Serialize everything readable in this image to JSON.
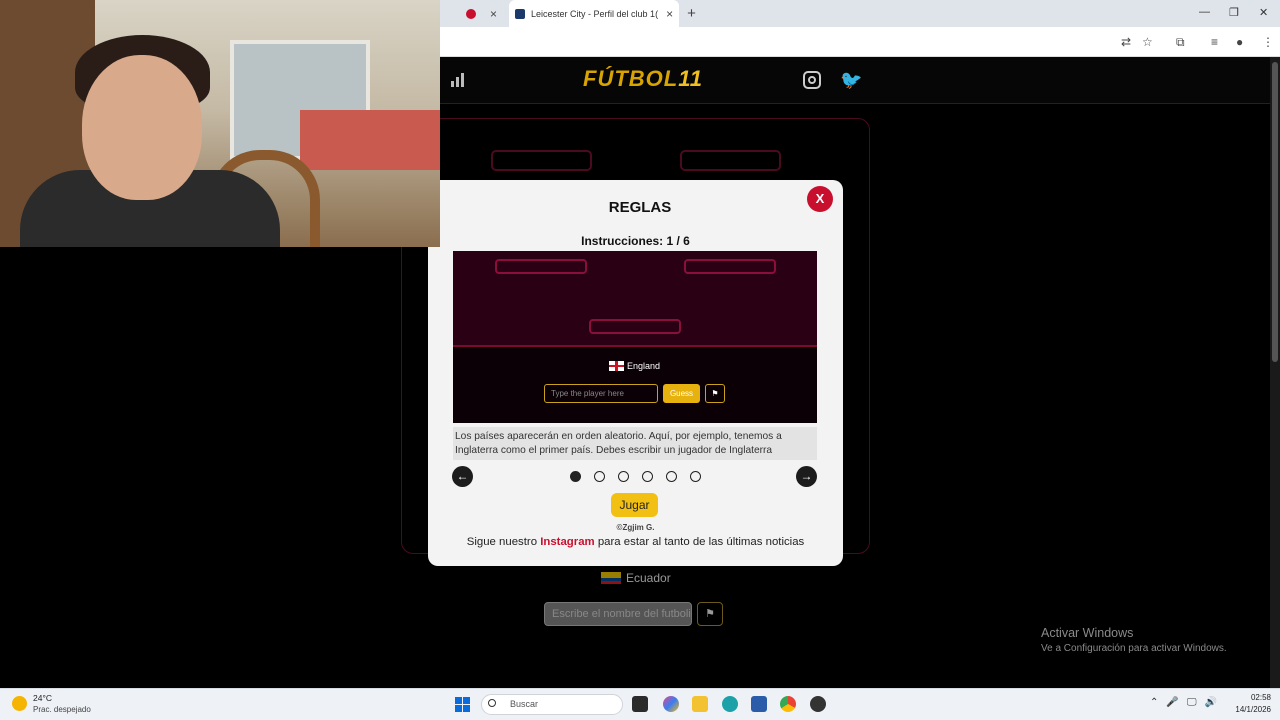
{
  "browser": {
    "tabs": [
      {
        "label": "",
        "favicon_color": "#c8102e"
      },
      {
        "label": "Leicester City - Perfil del club 1(",
        "favicon_color": "#1b3a6b"
      }
    ]
  },
  "site": {
    "logo_prefix": "FÚTBOL",
    "logo_suffix": "11",
    "background_country": "Ecuador",
    "background_input_placeholder": "Escribe el nombre del futbolista",
    "flag_button": "⚑"
  },
  "modal": {
    "title": "REGLAS",
    "close_label": "X",
    "instructions": "Instrucciones: 1 / 6",
    "preview": {
      "country": "England",
      "input_placeholder": "Type the player here",
      "guess_label": "Guess",
      "flag_label": "⚑"
    },
    "description": "Los países aparecerán en orden aleatorio. Aquí, por ejemplo, tenemos a Inglaterra como el primer país. Debes escribir un jugador de Inglaterra",
    "pagination": {
      "current": 1,
      "total": 6
    },
    "play_label": "Jugar",
    "copyright": "©Zgjim G.",
    "follow_prefix": "Sigue nuestro ",
    "follow_link": "Instagram",
    "follow_suffix": " para estar al tanto de las últimas noticias"
  },
  "watermark": {
    "title": "Activar Windows",
    "subtitle": "Ve a Configuración para activar Windows."
  },
  "taskbar": {
    "weather_temp": "24°C",
    "weather_desc": "Prac. despejado",
    "search_placeholder": "Buscar",
    "time": "02:58",
    "date": "14/1/2026"
  }
}
